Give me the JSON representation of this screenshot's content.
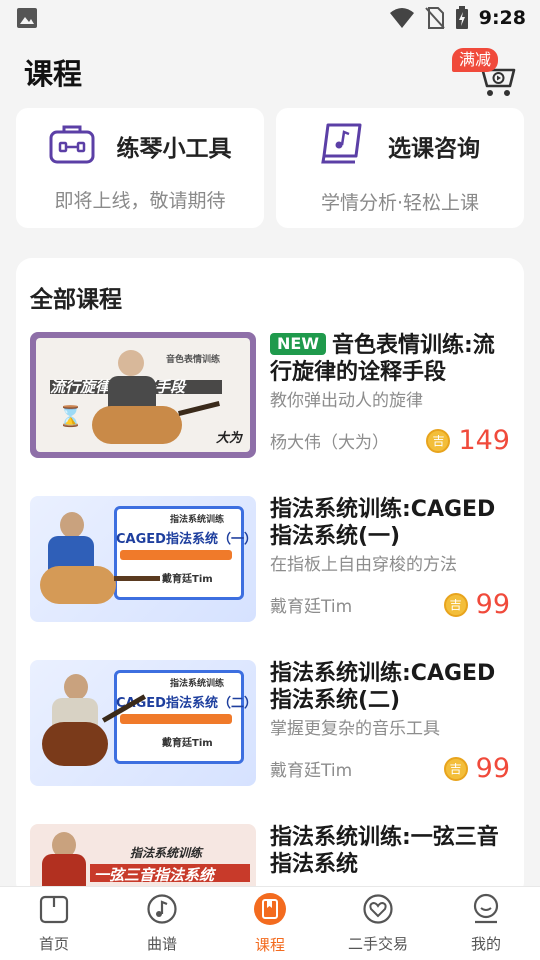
{
  "status": {
    "time": "9:28"
  },
  "header": {
    "title": "课程",
    "cart_badge": "满减"
  },
  "tools": [
    {
      "title": "练琴小工具",
      "subtitle": "即将上线，敬请期待",
      "icon": "toolbox-icon"
    },
    {
      "title": "选课咨询",
      "subtitle": "学情分析·轻松上课",
      "icon": "music-book-icon"
    }
  ],
  "courses_section": {
    "title": "全部课程",
    "items": [
      {
        "badge": "NEW",
        "title": "音色表情训练:流行旋律的诠释手段",
        "desc": "教你弹出动人的旋律",
        "teacher": "杨大伟（大为）",
        "price": "149",
        "thumb_line1": "音色表情训练",
        "thumb_line2": "流行旋律的诠释手段",
        "thumb_sign": "大为"
      },
      {
        "badge": "",
        "title": "指法系统训练:CAGED指法系统(一)",
        "desc": "在指板上自由穿梭的方法",
        "teacher": "戴育廷Tim",
        "price": "99",
        "thumb_line1": "指法系统训练",
        "thumb_line2": "CAGED指法系统（一）",
        "thumb_sign": "戴育廷Tim"
      },
      {
        "badge": "",
        "title": "指法系统训练:CAGED指法系统(二)",
        "desc": "掌握更复杂的音乐工具",
        "teacher": "戴育廷Tim",
        "price": "99",
        "thumb_line1": "指法系统训练",
        "thumb_line2": "CAGED指法系统（二）",
        "thumb_sign": "戴育廷Tim"
      },
      {
        "badge": "",
        "title": "指法系统训练:一弦三音指法系统",
        "desc": "",
        "teacher": "",
        "price": "",
        "thumb_line1": "指法系统训练",
        "thumb_line2": "一弦三音指法系统",
        "thumb_sign": ""
      }
    ]
  },
  "tabbar": [
    {
      "label": "首页",
      "icon": "home-icon"
    },
    {
      "label": "曲谱",
      "icon": "music-note-icon"
    },
    {
      "label": "课程",
      "icon": "course-book-icon",
      "active": true
    },
    {
      "label": "二手交易",
      "icon": "trade-heart-icon"
    },
    {
      "label": "我的",
      "icon": "profile-icon"
    }
  ],
  "colors": {
    "accent": "#f36b1f",
    "price": "#f04a3b",
    "new_badge": "#1f9a4c",
    "icon_purple": "#5b3fa6"
  }
}
